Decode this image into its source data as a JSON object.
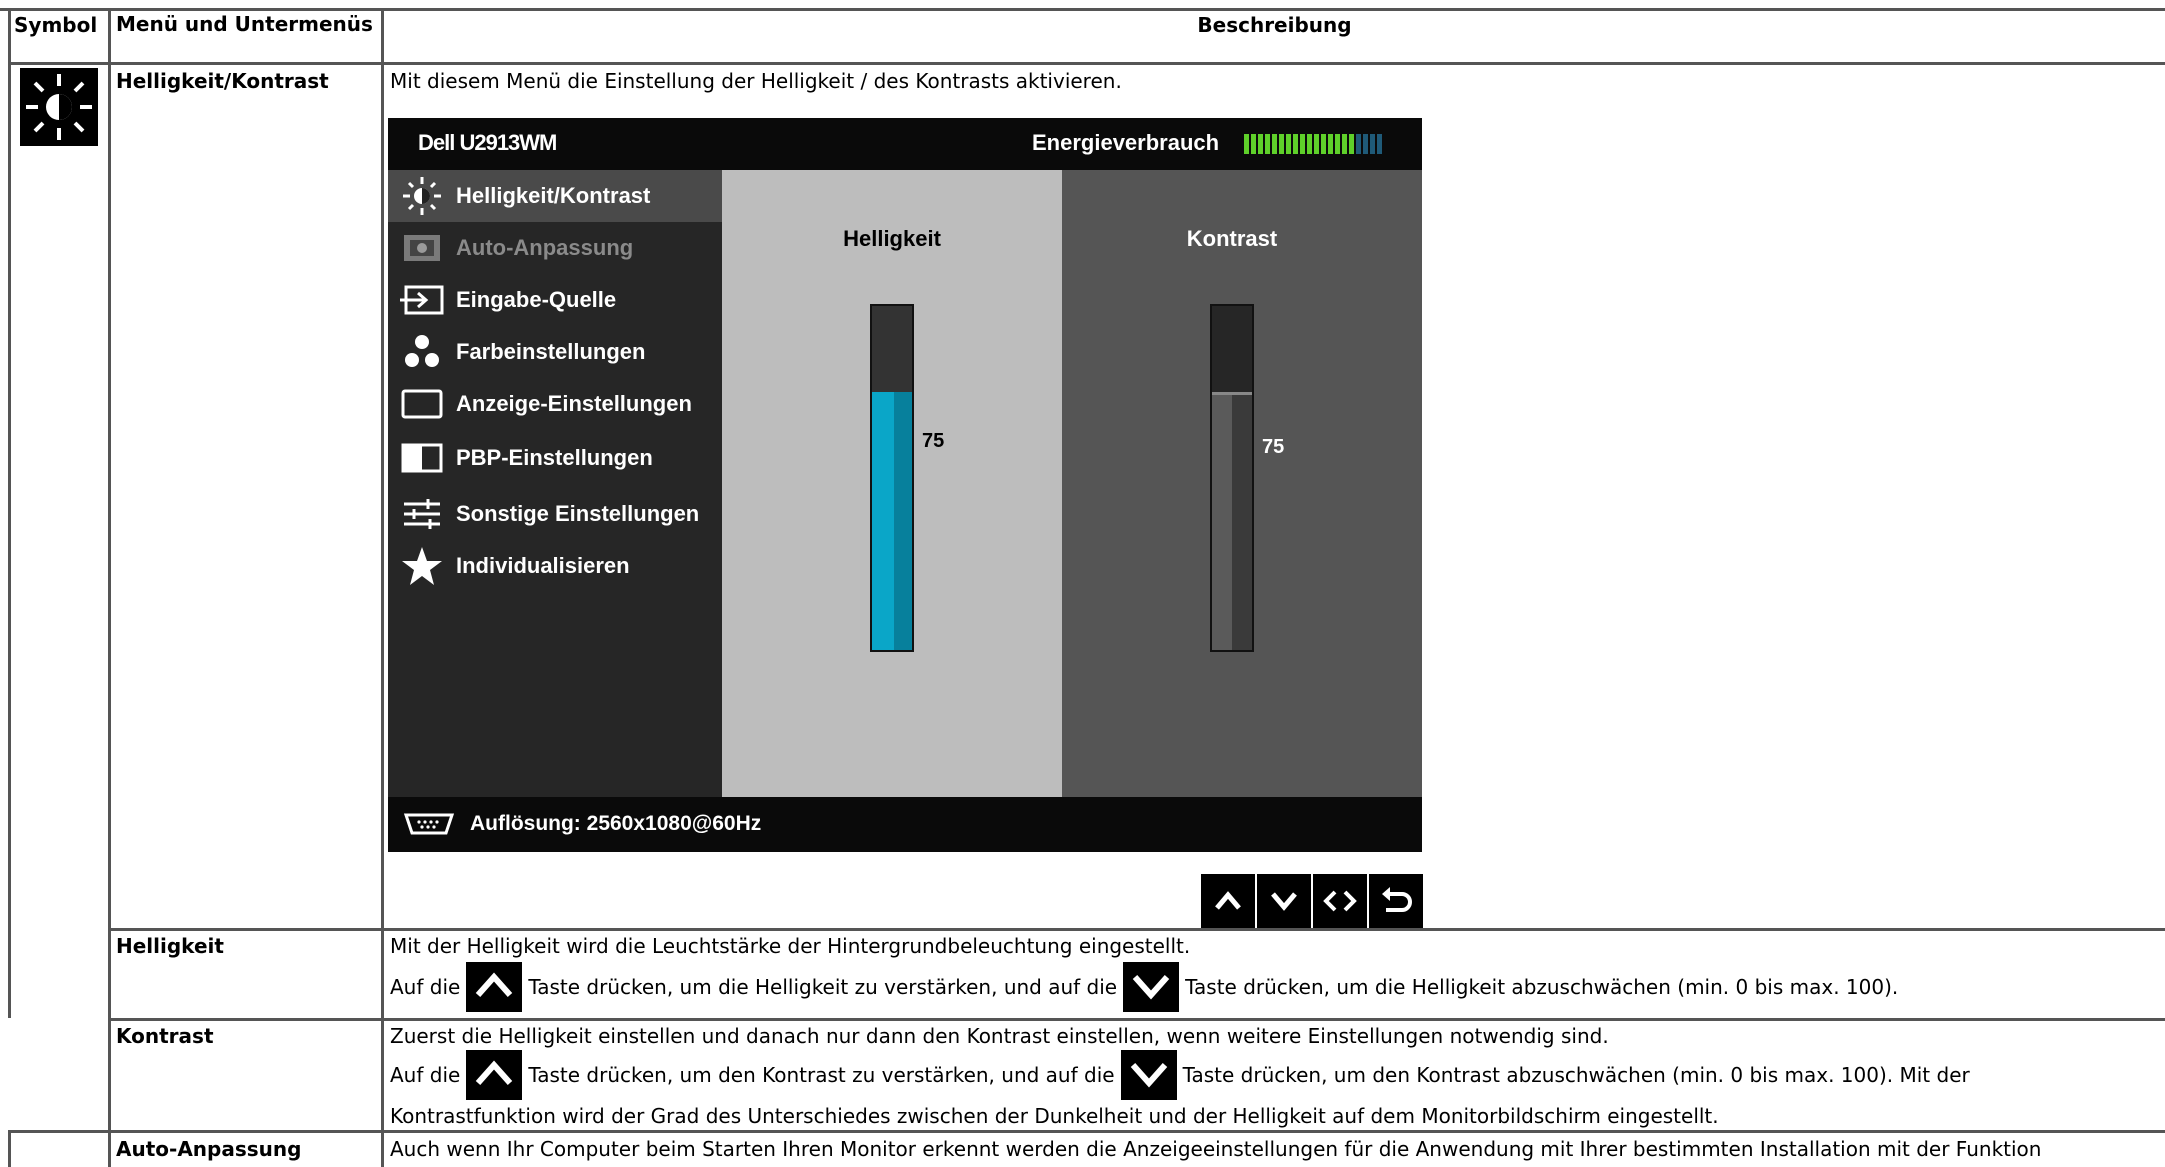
{
  "table": {
    "headers": {
      "symbol": "Symbol",
      "menu": "Menü und Untermenüs",
      "description": "Beschreibung"
    },
    "rows": [
      {
        "menu": "Helligkeit/Kontrast",
        "icon": "brightness-icon",
        "description": "Mit diesem Menü die Einstellung der Helligkeit / des Kontrasts aktivieren."
      },
      {
        "menu": "Helligkeit",
        "line1": "Mit der Helligkeit wird die Leuchtstärke der Hintergrundbeleuchtung eingestellt.",
        "line2a": "Auf die",
        "line2b": "Taste drücken, um die Helligkeit zu verstärken, und auf die",
        "line2c": "Taste drücken, um die Helligkeit abzuschwächen (min. 0 bis max. 100)."
      },
      {
        "menu": "Kontrast",
        "line1": "Zuerst die Helligkeit einstellen und danach nur dann den Kontrast einstellen, wenn weitere Einstellungen notwendig sind.",
        "line2a": "Auf die",
        "line2b": "Taste drücken, um den Kontrast zu verstärken, und auf die",
        "line2c": "Taste drücken, um den Kontrast abzuschwächen (min. 0 bis max. 100). Mit der",
        "line3": "Kontrastfunktion wird der Grad des Unterschiedes zwischen der Dunkelheit und der Helligkeit auf dem Monitorbildschirm eingestellt."
      },
      {
        "menu": "Auto-Anpassung",
        "description": "Auch wenn Ihr Computer beim Starten Ihren Monitor erkennt werden die Anzeigeeinstellungen für die Anwendung mit Ihrer bestimmten Installation mit der Funktion"
      }
    ]
  },
  "osd": {
    "model": "Dell U2913WM",
    "energy_label": "Energieverbrauch",
    "energy_level": 0.8,
    "menu": [
      {
        "label": "Helligkeit/Kontrast",
        "icon": "brightness-icon",
        "selected": true
      },
      {
        "label": "Auto-Anpassung",
        "icon": "auto-adjust-icon",
        "dimmed": true
      },
      {
        "label": "Eingabe-Quelle",
        "icon": "input-source-icon"
      },
      {
        "label": "Farbeinstellungen",
        "icon": "color-dots-icon"
      },
      {
        "label": "Anzeige-Einstellungen",
        "icon": "display-rect-icon"
      },
      {
        "label": "PBP-Einstellungen",
        "icon": "pbp-icon"
      },
      {
        "label": "Sonstige Einstellungen",
        "icon": "sliders-icon"
      },
      {
        "label": "Individualisieren",
        "icon": "star-icon"
      }
    ],
    "brightness": {
      "label": "Helligkeit",
      "value": "75",
      "level": 0.75,
      "color": "#0aa6c8"
    },
    "contrast": {
      "label": "Kontrast",
      "value": "75",
      "level": 0.75
    },
    "resolution": "Auflösung: 2560x1080@60Hz",
    "nav_buttons": [
      "up-icon",
      "down-icon",
      "left-right-icon",
      "back-icon"
    ]
  }
}
